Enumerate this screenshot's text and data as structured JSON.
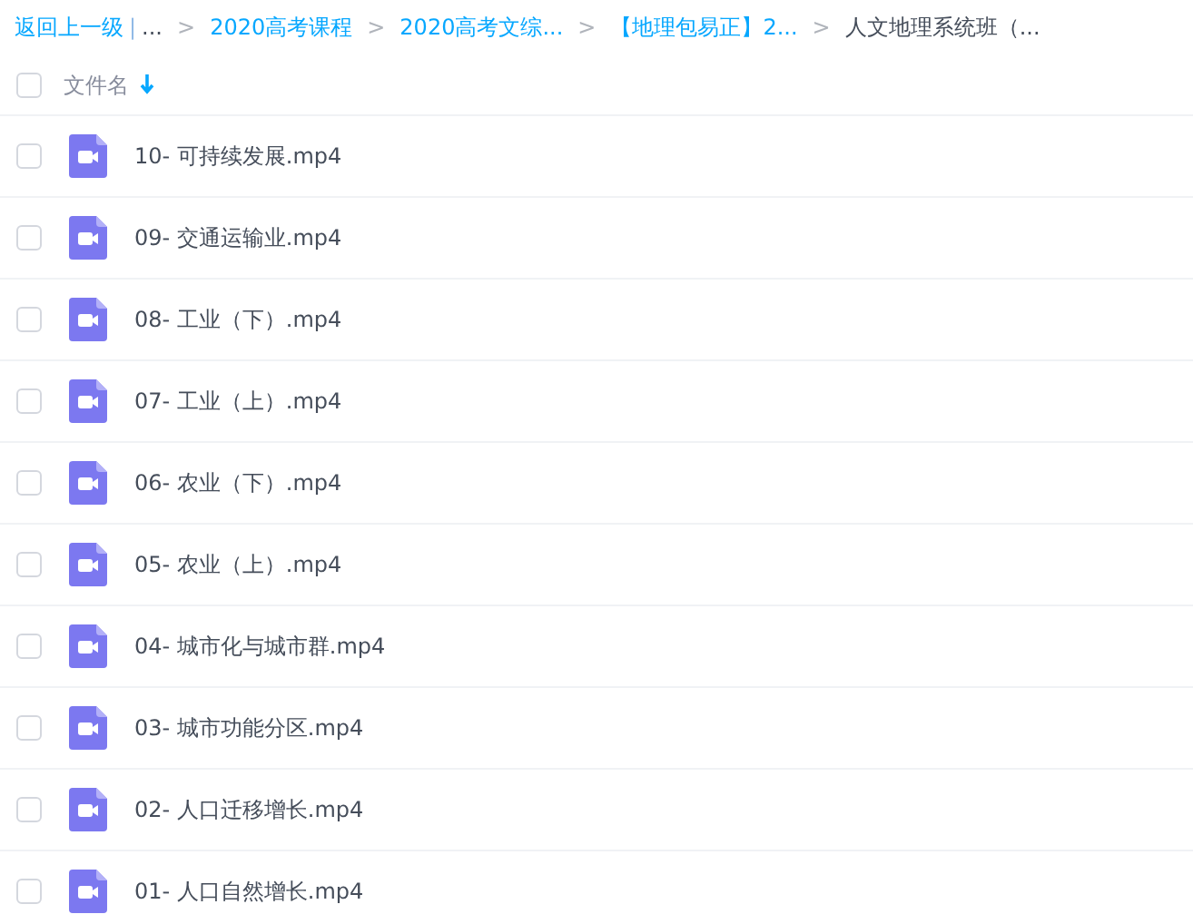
{
  "breadcrumb": [
    {
      "kind": "link",
      "text": "返回上一级"
    },
    {
      "kind": "divider",
      "text": "|"
    },
    {
      "kind": "plain",
      "text": "..."
    },
    {
      "kind": "separator",
      "text": ">"
    },
    {
      "kind": "link",
      "text": "2020高考课程"
    },
    {
      "kind": "separator",
      "text": ">"
    },
    {
      "kind": "link",
      "text": "2020高考文综..."
    },
    {
      "kind": "separator",
      "text": ">"
    },
    {
      "kind": "link",
      "text": "【地理包易正】2..."
    },
    {
      "kind": "separator",
      "text": ">"
    },
    {
      "kind": "plain",
      "text": "人文地理系统班（..."
    }
  ],
  "header": {
    "checked": false,
    "column": "文件名",
    "sort_descending": true
  },
  "files": [
    {
      "name": "10- 可持续发展.mp4",
      "checked": false
    },
    {
      "name": "09- 交通运输业.mp4",
      "checked": false
    },
    {
      "name": "08- 工业（下）.mp4",
      "checked": false
    },
    {
      "name": "07- 工业（上）.mp4",
      "checked": false
    },
    {
      "name": "06- 农业（下）.mp4",
      "checked": false
    },
    {
      "name": "05- 农业（上）.mp4",
      "checked": false
    },
    {
      "name": "04- 城市化与城市群.mp4",
      "checked": false
    },
    {
      "name": "03- 城市功能分区.mp4",
      "checked": false
    },
    {
      "name": "02- 人口迁移增长.mp4",
      "checked": false
    },
    {
      "name": "01- 人口自然增长.mp4",
      "checked": false
    }
  ]
}
